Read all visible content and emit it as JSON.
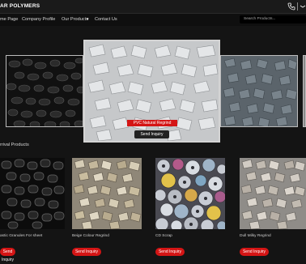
{
  "header": {
    "brand": "AR POLYMERS",
    "phone_icon": "phone-icon",
    "extra_icon": "mail-icon"
  },
  "nav": {
    "items": [
      "me Page",
      "Company Profile",
      "Our Products",
      "Contact Us"
    ],
    "products_caret": "▾",
    "search_placeholder": "Search Products..."
  },
  "hero": {
    "caption": "PVC Natural Regrind",
    "button": "Send Inquiry"
  },
  "section": {
    "title": "rrival Products"
  },
  "products": [
    {
      "name": "astic Granules For sheet",
      "button": "Send Inquiry"
    },
    {
      "name": "Beige Colour Regrind",
      "button": "Send Inquiry"
    },
    {
      "name": "CD Scrap",
      "button": "Send Inquiry"
    },
    {
      "name": "Dull Milky Regrind",
      "button": "Send Inquiry"
    }
  ],
  "colors": {
    "accent": "#d41515",
    "background": "#141414"
  }
}
